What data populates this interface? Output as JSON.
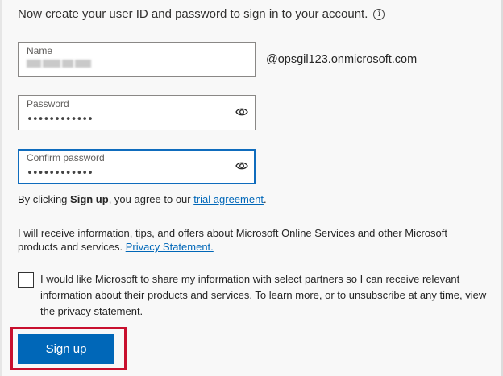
{
  "intro": {
    "text": "Now create your user ID and password to sign in to your account.",
    "info_glyph": "i"
  },
  "fields": {
    "name": {
      "label": "Name",
      "value": ""
    },
    "password": {
      "label": "Password",
      "value": "••••••••••••"
    },
    "confirm_password": {
      "label": "Confirm password",
      "value": "••••••••••••"
    }
  },
  "domain_suffix": "@opsgil123.onmicrosoft.com",
  "agreement": {
    "prefix": "By clicking ",
    "bold": "Sign up",
    "middle": ", you agree to our ",
    "link": "trial agreement",
    "suffix": "."
  },
  "info": {
    "text": "I will receive information, tips, and offers about Microsoft Online Services and other Microsoft products and services. ",
    "link": "Privacy Statement."
  },
  "consent": {
    "checked": false,
    "text": "I would like Microsoft to share my information with select partners so I can receive relevant information about their products and services. To learn more, or to unsubscribe at any time, view the privacy statement."
  },
  "signup_button": {
    "label": "Sign up"
  },
  "colors": {
    "accent": "#0067b8",
    "highlight": "#c8102e",
    "focus_border": "#0f6cbd"
  },
  "icons": {
    "info": "info-icon",
    "reveal": "eye-icon"
  }
}
